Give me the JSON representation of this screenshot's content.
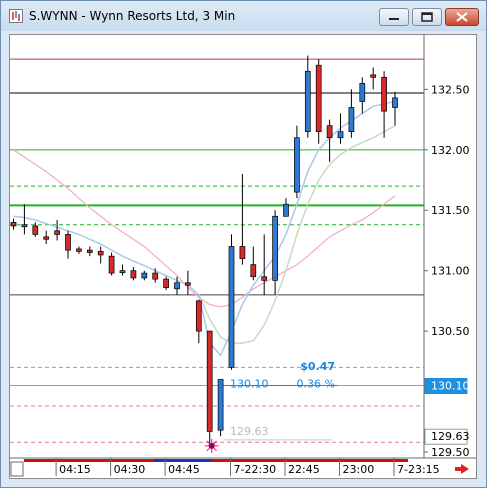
{
  "window": {
    "title": "S.WYNN - Wynn Resorts Ltd, 3 Min",
    "controls": [
      "minimize",
      "restore",
      "close"
    ]
  },
  "chart_data": {
    "type": "candlestick",
    "symbol": "S.WYNN",
    "ylim": [
      129.45,
      132.95
    ],
    "y_ticks": [
      {
        "label": "132.50",
        "value": 132.5
      },
      {
        "label": "132.00",
        "value": 132.0
      },
      {
        "label": "131.50",
        "value": 131.5
      },
      {
        "label": "131.00",
        "value": 131.0
      },
      {
        "label": "130.50",
        "value": 130.5
      },
      {
        "label": "129.50",
        "value": 129.5
      }
    ],
    "x_ticks": [
      {
        "label": "04:15",
        "bar": 4
      },
      {
        "label": "04:30",
        "bar": 9
      },
      {
        "label": "04:45",
        "bar": 14
      },
      {
        "label": "7-22:30",
        "bar": 20
      },
      {
        "label": "22:45",
        "bar": 25
      },
      {
        "label": "23:00",
        "bar": 30
      },
      {
        "label": "7-23:15",
        "bar": 35
      }
    ],
    "candles": [
      {
        "o": 131.4,
        "h": 131.43,
        "l": 131.34,
        "c": 131.37
      },
      {
        "o": 131.38,
        "h": 131.55,
        "l": 131.3,
        "c": 131.38
      },
      {
        "o": 131.37,
        "h": 131.4,
        "l": 131.28,
        "c": 131.3
      },
      {
        "o": 131.28,
        "h": 131.33,
        "l": 131.22,
        "c": 131.26
      },
      {
        "o": 131.33,
        "h": 131.42,
        "l": 131.25,
        "c": 131.3
      },
      {
        "o": 131.3,
        "h": 131.33,
        "l": 131.1,
        "c": 131.17
      },
      {
        "o": 131.18,
        "h": 131.2,
        "l": 131.14,
        "c": 131.16
      },
      {
        "o": 131.17,
        "h": 131.2,
        "l": 131.12,
        "c": 131.15
      },
      {
        "o": 131.16,
        "h": 131.2,
        "l": 131.06,
        "c": 131.13
      },
      {
        "o": 131.12,
        "h": 131.15,
        "l": 130.96,
        "c": 130.98
      },
      {
        "o": 131.0,
        "h": 131.05,
        "l": 130.96,
        "c": 131.0
      },
      {
        "o": 131.0,
        "h": 131.03,
        "l": 130.92,
        "c": 130.94
      },
      {
        "o": 130.94,
        "h": 131.0,
        "l": 130.92,
        "c": 130.98
      },
      {
        "o": 130.98,
        "h": 131.02,
        "l": 130.9,
        "c": 130.93
      },
      {
        "o": 130.93,
        "h": 130.95,
        "l": 130.84,
        "c": 130.86
      },
      {
        "o": 130.85,
        "h": 130.95,
        "l": 130.8,
        "c": 130.9
      },
      {
        "o": 130.9,
        "h": 131.0,
        "l": 130.8,
        "c": 130.88
      },
      {
        "o": 130.75,
        "h": 130.76,
        "l": 130.4,
        "c": 130.5
      },
      {
        "o": 130.5,
        "h": 130.5,
        "l": 129.55,
        "c": 129.67
      },
      {
        "o": 129.68,
        "h": 130.1,
        "l": 129.63,
        "c": 130.1
      },
      {
        "o": 130.2,
        "h": 131.3,
        "l": 130.18,
        "c": 131.2
      },
      {
        "o": 131.2,
        "h": 131.8,
        "l": 131.05,
        "c": 131.1
      },
      {
        "o": 131.05,
        "h": 131.2,
        "l": 130.92,
        "c": 130.95
      },
      {
        "o": 130.95,
        "h": 131.3,
        "l": 130.8,
        "c": 130.92
      },
      {
        "o": 130.92,
        "h": 131.5,
        "l": 130.8,
        "c": 131.45
      },
      {
        "o": 131.45,
        "h": 131.6,
        "l": 131.45,
        "c": 131.55
      },
      {
        "o": 131.65,
        "h": 132.2,
        "l": 131.6,
        "c": 132.1
      },
      {
        "o": 132.15,
        "h": 132.78,
        "l": 132.1,
        "c": 132.65
      },
      {
        "o": 132.7,
        "h": 132.75,
        "l": 132.05,
        "c": 132.15
      },
      {
        "o": 132.2,
        "h": 132.25,
        "l": 131.9,
        "c": 132.1
      },
      {
        "o": 132.1,
        "h": 132.3,
        "l": 132.05,
        "c": 132.15
      },
      {
        "o": 132.15,
        "h": 132.5,
        "l": 132.1,
        "c": 132.35
      },
      {
        "o": 132.4,
        "h": 132.6,
        "l": 132.3,
        "c": 132.55
      },
      {
        "o": 132.62,
        "h": 132.68,
        "l": 132.5,
        "c": 132.6
      },
      {
        "o": 132.6,
        "h": 132.65,
        "l": 132.1,
        "c": 132.32
      },
      {
        "o": 132.35,
        "h": 132.48,
        "l": 132.2,
        "c": 132.43
      }
    ],
    "overlays": {
      "ma_fast_color": "#a9c8ea",
      "ma_slow_color": "#c5ddc0",
      "ma_pink_color": "#f5a9c6",
      "ma_fast": [
        131.45,
        131.44,
        131.42,
        131.39,
        131.36,
        131.33,
        131.3,
        131.26,
        131.22,
        131.17,
        131.12,
        131.08,
        131.04,
        131.0,
        130.96,
        130.92,
        130.88,
        130.8,
        130.4,
        130.3,
        130.5,
        130.72,
        130.88,
        131.0,
        131.12,
        131.3,
        131.55,
        131.82,
        132.0,
        132.1,
        132.18,
        132.24,
        132.3,
        132.36,
        132.38,
        132.4
      ],
      "ma_slow": [
        null,
        null,
        null,
        null,
        null,
        null,
        null,
        null,
        null,
        null,
        null,
        null,
        null,
        null,
        null,
        null,
        null,
        130.8,
        130.6,
        130.45,
        130.4,
        130.4,
        130.42,
        130.55,
        130.75,
        131.0,
        131.3,
        131.55,
        131.75,
        131.88,
        131.96,
        132.02,
        132.06,
        132.1,
        132.15,
        132.2
      ],
      "ma_pink": [
        132.0,
        131.94,
        131.88,
        131.82,
        131.75,
        131.68,
        131.6,
        131.52,
        131.45,
        131.38,
        131.32,
        131.26,
        131.2,
        131.12,
        131.04,
        130.96,
        130.86,
        130.78,
        130.72,
        130.7,
        130.72,
        130.78,
        130.85,
        130.9,
        130.95,
        131.0,
        131.05,
        131.12,
        131.2,
        131.28,
        131.33,
        131.38,
        131.42,
        131.48,
        131.55,
        131.62
      ]
    },
    "hlines": [
      {
        "value": 132.75,
        "color": "#b83a3a",
        "style": "solid",
        "width": 1
      },
      {
        "value": 132.47,
        "color": "#000000",
        "style": "solid",
        "width": 1
      },
      {
        "value": 132.0,
        "color": "#22b422",
        "style": "solid",
        "width": 1
      },
      {
        "value": 131.7,
        "color": "#22b422",
        "style": "dashed",
        "width": 1
      },
      {
        "value": 131.54,
        "color": "#22b422",
        "style": "solid",
        "width": 2
      },
      {
        "value": 131.38,
        "color": "#22b422",
        "style": "dashed",
        "width": 1
      },
      {
        "value": 130.8,
        "color": "#444444",
        "style": "solid",
        "width": 1
      },
      {
        "value": 130.2,
        "color": "#e07aa8",
        "style": "dashed",
        "width": 1
      },
      {
        "value": 130.05,
        "color": "#e07aa8",
        "style": "solid",
        "width": 1
      },
      {
        "value": 129.88,
        "color": "#e07aa8",
        "style": "dashed",
        "width": 1
      },
      {
        "value": 129.58,
        "color": "#e07aa8",
        "style": "dashed",
        "width": 1
      }
    ],
    "annotations": {
      "change_value": "$0.47",
      "change_percent": "0.36 %",
      "start_price_label": "130.10",
      "low_label": "129.63"
    },
    "price_flags": [
      {
        "label": "130.10",
        "value": 130.05,
        "bg": "#1e90e0",
        "fg": "#ffffff"
      },
      {
        "label": "129.63",
        "value": 129.63,
        "bg": "#ffffff",
        "fg": "#000000"
      }
    ],
    "colors": {
      "up_fill": "#2b7bd6",
      "down_fill": "#d42a2a",
      "annotation_blue": "#1a86e0",
      "low_label_gray": "#b8b8b8",
      "x_range_bar": "#d40f0f",
      "x_range_bar_blue": "#1a35b8",
      "nav_arrow": "#e02020"
    }
  }
}
